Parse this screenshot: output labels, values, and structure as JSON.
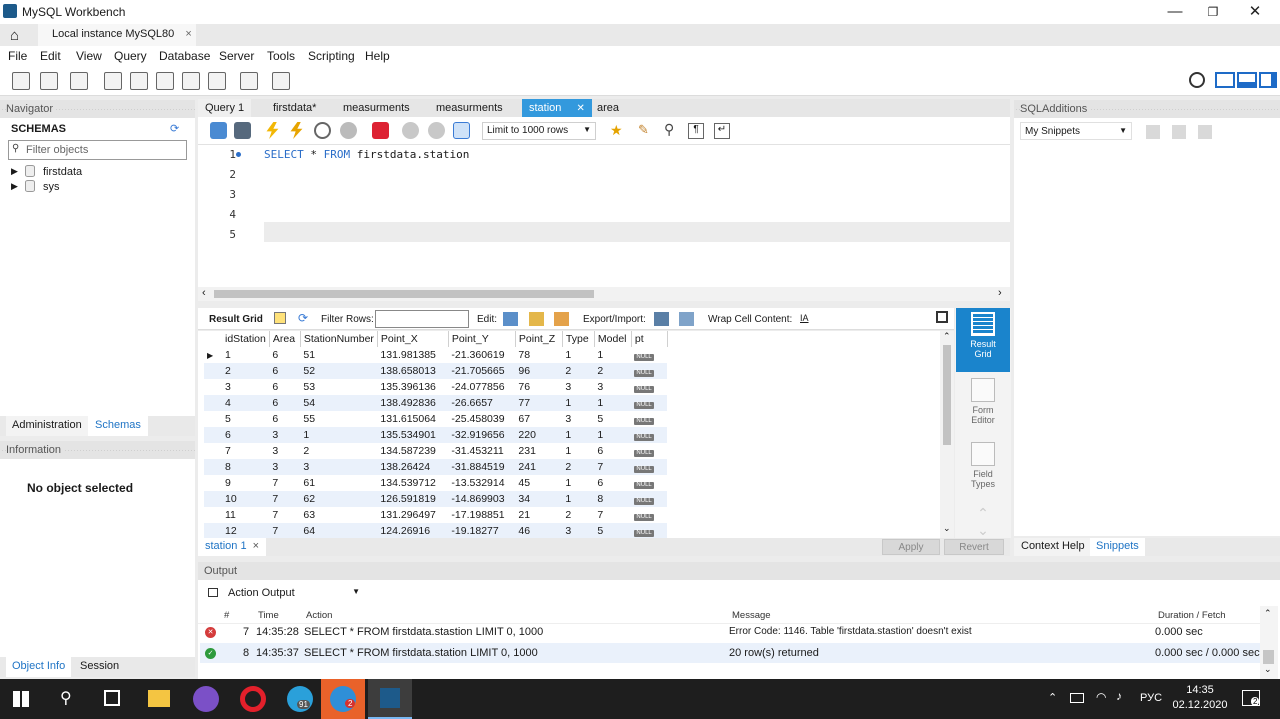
{
  "window": {
    "title": "MySQL Workbench"
  },
  "connection_tab": {
    "label": "Local instance MySQL80",
    "close": "×"
  },
  "menu": [
    "File",
    "Edit",
    "View",
    "Query",
    "Database",
    "Server",
    "Tools",
    "Scripting",
    "Help"
  ],
  "navigator": {
    "header": "Navigator",
    "schemas_title": "SCHEMAS",
    "filter_placeholder": "Filter objects",
    "schemas": [
      "firstdata",
      "sys"
    ],
    "tabs": [
      "Administration",
      "Schemas"
    ]
  },
  "information": {
    "header": "Information",
    "message": "No object selected",
    "tabs": [
      "Object Info",
      "Session"
    ]
  },
  "editor_tabs": [
    "Query 1",
    "firstdata*",
    "measurments",
    "measurments",
    "station",
    "area"
  ],
  "active_editor_tab": "station",
  "limit_select": "Limit to 1000 rows",
  "sql": {
    "line_numbers": [
      "1",
      "2",
      "3",
      "4",
      "5"
    ],
    "kw1": "SELECT",
    "rest1": " * ",
    "kw2": "FROM",
    "rest2": " firstdata.station"
  },
  "result_toolbar": {
    "result_grid": "Result Grid",
    "filter_rows": "Filter Rows:",
    "edit": "Edit:",
    "export_import": "Export/Import:",
    "wrap": "Wrap Cell Content:"
  },
  "grid": {
    "columns": [
      "idStation",
      "Area",
      "StationNumber",
      "Point_X",
      "Point_Y",
      "Point_Z",
      "Type",
      "Model",
      "pt"
    ],
    "null_label": "NULL",
    "rows": [
      [
        "1",
        "6",
        "51",
        "131.981385",
        "-21.360619",
        "78",
        "1",
        "1"
      ],
      [
        "2",
        "6",
        "52",
        "138.658013",
        "-21.705665",
        "96",
        "2",
        "2"
      ],
      [
        "3",
        "6",
        "53",
        "135.396136",
        "-24.077856",
        "76",
        "3",
        "3"
      ],
      [
        "4",
        "6",
        "54",
        "138.492836",
        "-26.6657",
        "77",
        "1",
        "1"
      ],
      [
        "5",
        "6",
        "55",
        "131.615064",
        "-25.458039",
        "67",
        "3",
        "5"
      ],
      [
        "6",
        "3",
        "1",
        "135.534901",
        "-32.919656",
        "220",
        "1",
        "1"
      ],
      [
        "7",
        "3",
        "2",
        "134.587239",
        "-31.453211",
        "231",
        "1",
        "6"
      ],
      [
        "8",
        "3",
        "3",
        "138.26424",
        "-31.884519",
        "241",
        "2",
        "7"
      ],
      [
        "9",
        "7",
        "61",
        "134.539712",
        "-13.532914",
        "45",
        "1",
        "6"
      ],
      [
        "10",
        "7",
        "62",
        "126.591819",
        "-14.869903",
        "34",
        "1",
        "8"
      ],
      [
        "11",
        "7",
        "63",
        "131.296497",
        "-17.198851",
        "21",
        "2",
        "7"
      ],
      [
        "12",
        "7",
        "64",
        "124.26916",
        "-19.18277",
        "46",
        "3",
        "5"
      ]
    ]
  },
  "side_panel": [
    {
      "label1": "Result",
      "label2": "Grid"
    },
    {
      "label1": "Form",
      "label2": "Editor"
    },
    {
      "label1": "Field",
      "label2": "Types"
    }
  ],
  "result_tab": {
    "label": "station 1",
    "close": "×"
  },
  "buttons": {
    "apply": "Apply",
    "revert": "Revert"
  },
  "sql_additions": {
    "header": "SQLAdditions",
    "snippets_select": "My Snippets",
    "tabs": [
      "Context Help",
      "Snippets"
    ]
  },
  "output": {
    "header": "Output",
    "mode": "Action Output",
    "columns": [
      "#",
      "Time",
      "Action",
      "Message",
      "Duration / Fetch"
    ],
    "rows": [
      {
        "status": "error",
        "num": "7",
        "time": "14:35:28",
        "action": "SELECT * FROM firstdata.stastion LIMIT 0, 1000",
        "message": "Error Code: 1146. Table 'firstdata.stastion' doesn't exist",
        "duration": "0.000 sec"
      },
      {
        "status": "ok",
        "num": "8",
        "time": "14:35:37",
        "action": "SELECT * FROM firstdata.station LIMIT 0, 1000",
        "message": "20 row(s) returned",
        "duration": "0.000 sec / 0.000 sec"
      }
    ]
  },
  "taskbar": {
    "time": "14:35",
    "date": "02.12.2020",
    "lang": "РУС",
    "telegram_badge": "91",
    "skype_badge": "2",
    "notif_badge": "2"
  },
  "colors": {
    "accent": "#0a84d0",
    "selected_tab": "#3399dd",
    "error": "#d43b3b",
    "ok": "#2e9a3c"
  }
}
